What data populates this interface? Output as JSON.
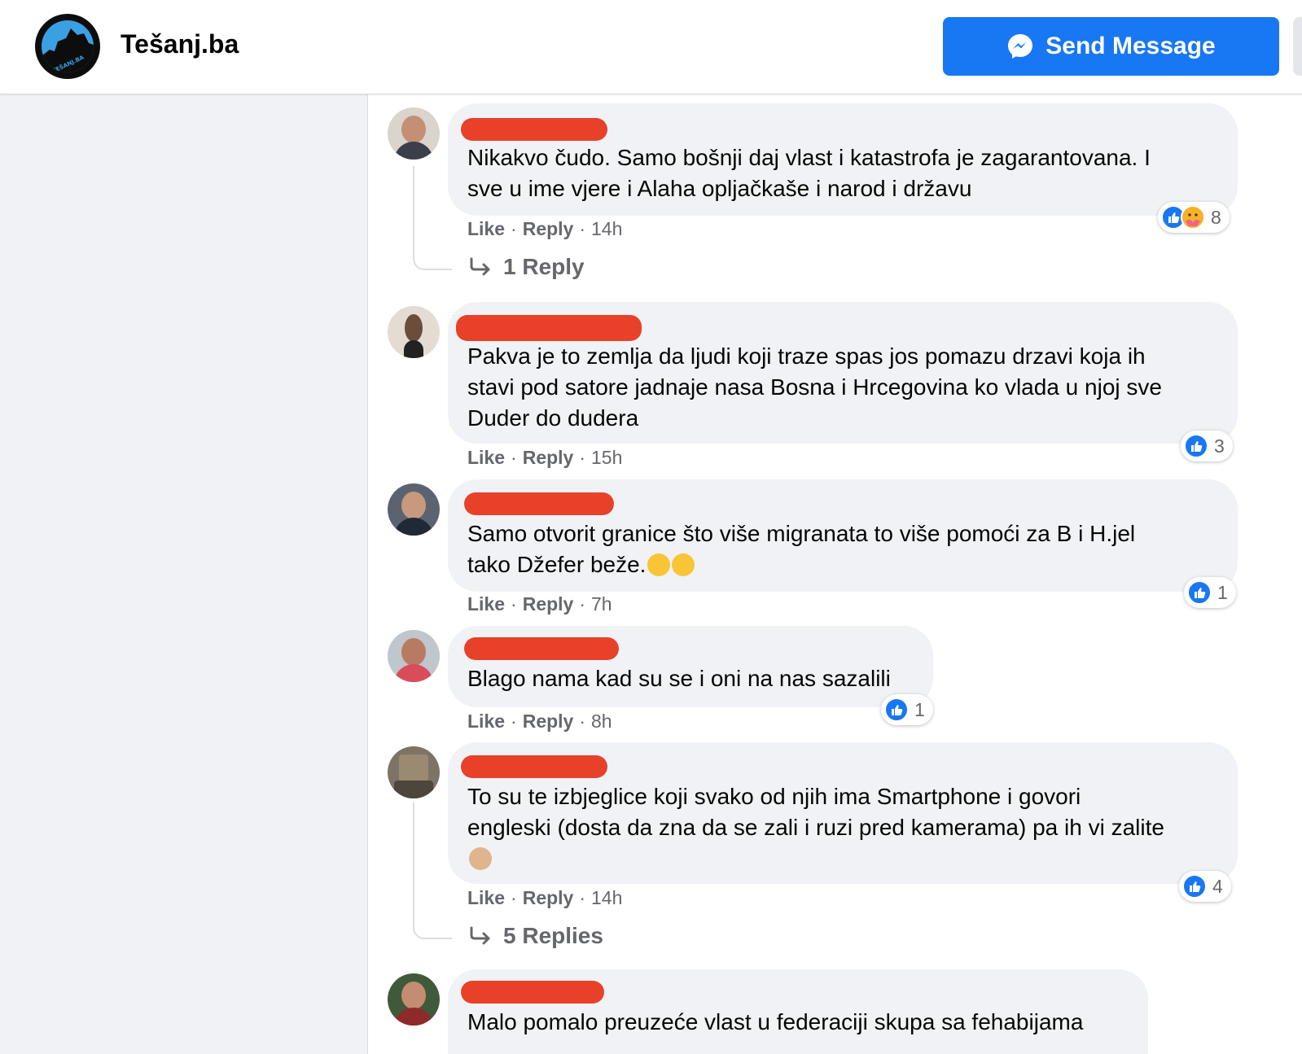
{
  "header": {
    "page_name": "Tešanj.ba",
    "logo_text": "TEŠANJ.BA",
    "send_message_label": "Send Message"
  },
  "comments": [
    {
      "text_lines": [
        "Nikakvo čudo. Samo bošnji daj vlast i katastrofa je zagarantovana. I",
        "sve u ime vjere i Alaha opljačkaše i narod i državu"
      ],
      "like": "Like",
      "reply": "Reply",
      "time": "14h",
      "reactions": [
        "like-icon",
        "care-icon"
      ],
      "reaction_count": "8",
      "replies_label": "1 Reply"
    },
    {
      "text_lines": [
        "Pakva je to zemlja da ljudi koji traze spas jos pomazu drzavi koja ih",
        "stavi pod satore jadnaje nasa Bosna i Hrcegovina ko vlada u njoj sve",
        "Duder do dudera"
      ],
      "like": "Like",
      "reply": "Reply",
      "time": "15h",
      "reactions": [
        "like-icon"
      ],
      "reaction_count": "3"
    },
    {
      "text_lines": [
        "Samo otvorit granice što više migranata to više pomoći za B i H.jel",
        "tako Džefer beže."
      ],
      "like": "Like",
      "reply": "Reply",
      "time": "7h",
      "reactions": [
        "like-icon"
      ],
      "reaction_count": "1"
    },
    {
      "text_lines": [
        "Blago nama kad su se i oni na nas sazalili"
      ],
      "like": "Like",
      "reply": "Reply",
      "time": "8h",
      "reactions": [
        "like-icon"
      ],
      "reaction_count": "1"
    },
    {
      "text_lines": [
        "To su te izbjeglice koji svako od njih ima Smartphone i govori",
        "engleski (dosta da zna da se zali i ruzi pred kamerama) pa ih vi zalite"
      ],
      "like": "Like",
      "reply": "Reply",
      "time": "14h",
      "reactions": [
        "like-icon"
      ],
      "reaction_count": "4",
      "replies_label": "5 Replies"
    },
    {
      "text_lines": [
        "Malo pomalo preuzeće vlast u federaciji skupa sa fehabijama"
      ]
    }
  ],
  "colors": {
    "brand_blue": "#1877f2",
    "bubble_bg": "#f0f2f5",
    "redaction": "#e8412a",
    "meta_text": "#65676b"
  }
}
